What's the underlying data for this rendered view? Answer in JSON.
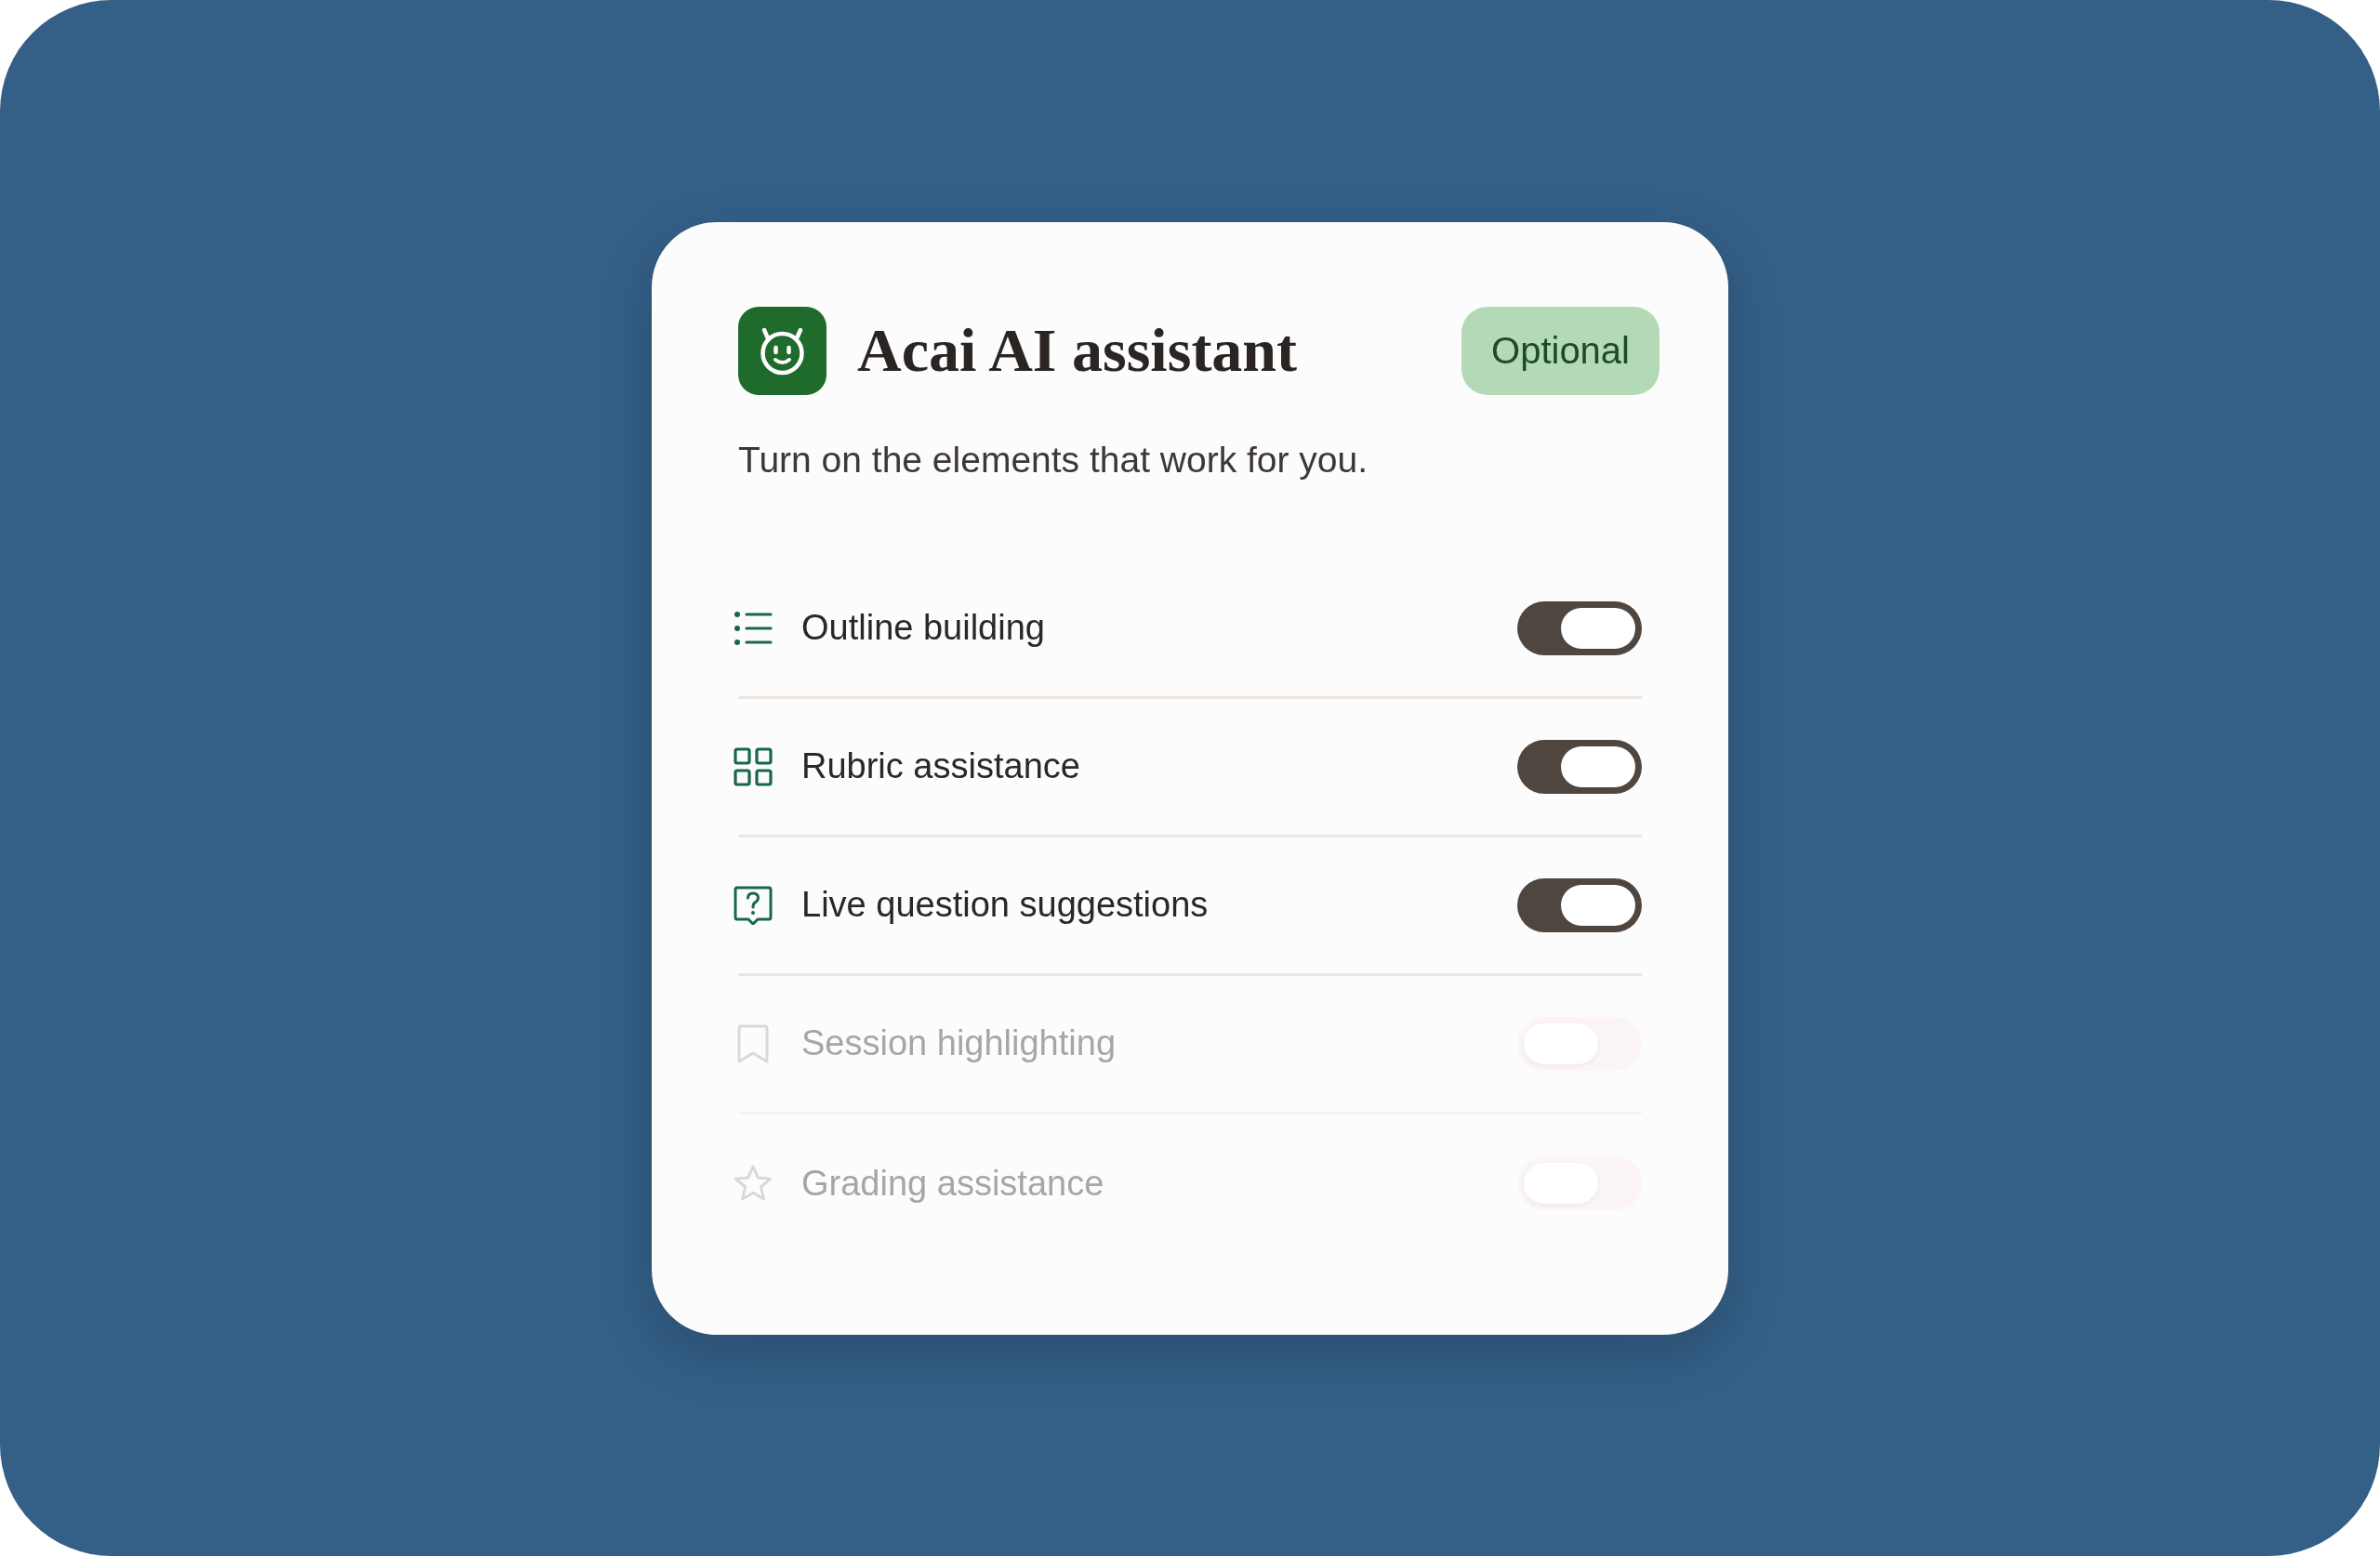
{
  "card": {
    "title": "Acai AI assistant",
    "badge": "Optional",
    "subtitle": "Turn on the elements that work for you."
  },
  "features": [
    {
      "label": "Outline building",
      "on": true,
      "disabled": false
    },
    {
      "label": "Rubric assistance",
      "on": true,
      "disabled": false
    },
    {
      "label": "Live question suggestions",
      "on": true,
      "disabled": false
    },
    {
      "label": "Session highlighting",
      "on": false,
      "disabled": true
    },
    {
      "label": "Grading assistance",
      "on": false,
      "disabled": true
    }
  ]
}
